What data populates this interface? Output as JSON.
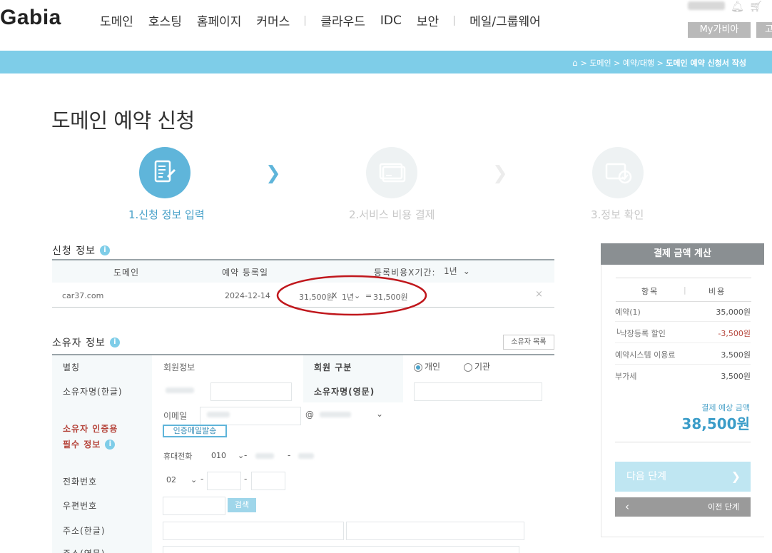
{
  "header": {
    "logo": "Gabia",
    "nav": [
      "도메인",
      "호스팅",
      "홈페이지",
      "커머스",
      "|",
      "클라우드",
      "IDC",
      "보안",
      "|",
      "메일/그룹웨어"
    ],
    "my_gabia": "My가비아",
    "extra_btn": "고"
  },
  "breadcrumb": {
    "items": [
      "도메인",
      "예약/대행"
    ],
    "current": "도메인 예약 신청서 작성",
    "sep": ">"
  },
  "page_title": "도메인 예약 신청",
  "steps": [
    "1.신청 정보 입력",
    "2.서비스 비용 결제",
    "3.정보 확인"
  ],
  "app_info": {
    "title": "신청 정보",
    "col_domain": "도메인",
    "col_date": "예약 등록일",
    "col_fee": "등록비용X기간:",
    "period_select": "1년",
    "domain": "car37.com",
    "date": "2024-12-14",
    "price": "31,500원",
    "times": "X",
    "row_period": "1년",
    "equals": "=",
    "total": "31,500원",
    "remove": "×"
  },
  "owner": {
    "title": "소유자 정보",
    "list_btn": "소유자 목록",
    "alias_label": "별칭",
    "alias_value": "회원정보",
    "member_type_label": "회원 구분",
    "type_individual": "개인",
    "type_org": "기관",
    "name_ko_label": "소유자명(한글)",
    "name_en_label": "소유자명(영문)",
    "verify_label_1": "소유자 인증용",
    "verify_label_2": "필수 정보",
    "email_label": "이메일",
    "at": "@",
    "send_btn": "인증메일발송",
    "mobile_label": "휴대전화",
    "mobile_prefix": "010",
    "dash": "-",
    "phone_label": "전화번호",
    "phone_prefix": "02",
    "zip_label": "우편번호",
    "search_btn": "검색",
    "addr_ko_label": "주소(한글)",
    "addr_en_label": "주소(영문)"
  },
  "calc": {
    "title": "결제 금액 계산",
    "col_item": "항목",
    "col_cost": "비용",
    "rows": [
      {
        "item": "예약(1)",
        "cost": "35,000원"
      },
      {
        "item": "└낙장등록 할인",
        "cost": "-3,500원"
      },
      {
        "item": "예약시스템 이용료",
        "cost": "3,500원"
      },
      {
        "item": "부가세",
        "cost": "3,500원"
      }
    ],
    "total_label": "결제 예상 금액",
    "total_value": "38,500원",
    "next_btn": "다음 단계",
    "prev_btn": "이전 단계"
  },
  "colors": {
    "accent": "#5fb5da",
    "discount": "#b5443a",
    "annotation": "#c0171c"
  }
}
